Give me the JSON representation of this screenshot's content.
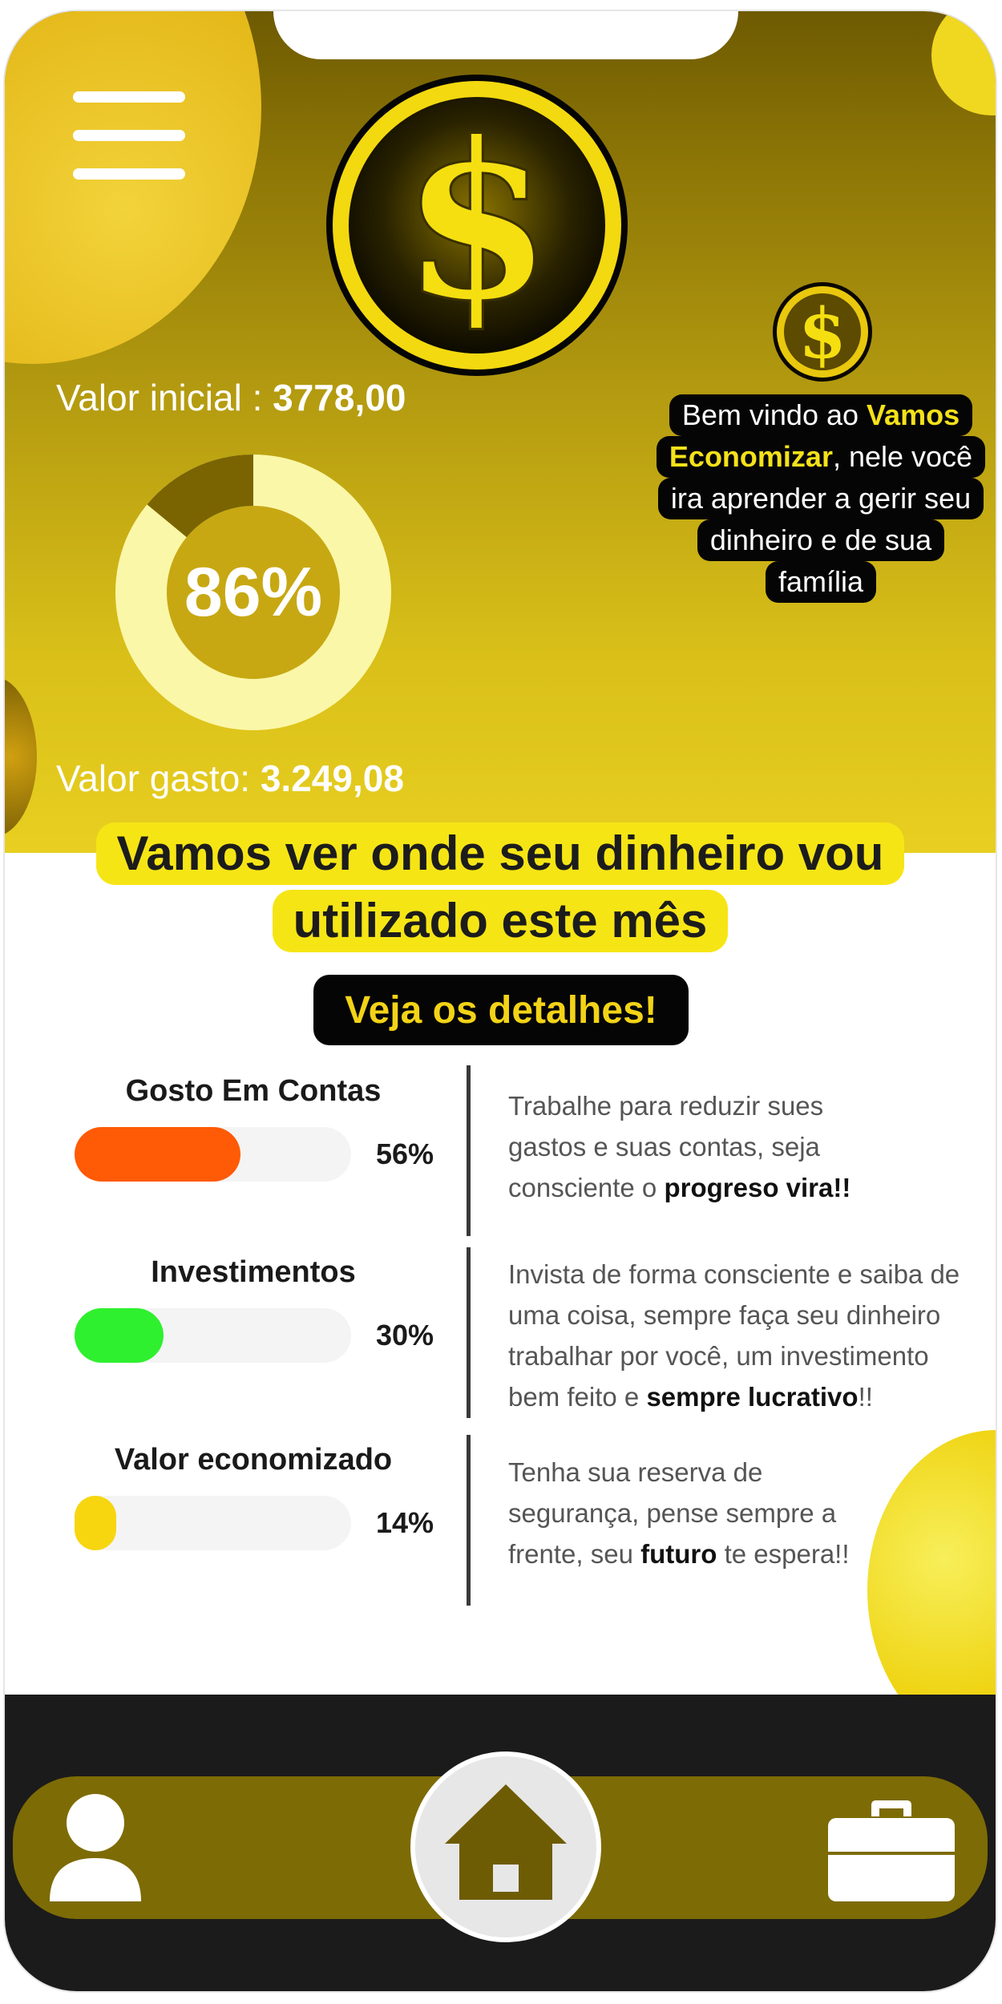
{
  "colors": {
    "accent_yellow": "#f6e515",
    "dark_gold": "#7d6b05",
    "bar_contas": "#ff5a05",
    "bar_invest": "#2ef02e",
    "bar_economia": "#f7d610",
    "track": "#f4f4f4"
  },
  "header": {
    "valor_inicial_label": "Valor inicial :",
    "valor_inicial_value": "3778,00",
    "valor_gasto_label": "Valor gasto:",
    "valor_gasto_value": "3.249,08",
    "percent_text": "86%",
    "percent_value": 86,
    "coin_symbol": "$"
  },
  "welcome": {
    "line1_prefix": "Bem vindo ao",
    "line1_highlight": "Vamos",
    "line2_highlight": "Economizar",
    "line2_suffix": ", nele você",
    "line3": "ira aprender a gerir seu",
    "line4": "dinheiro e de sua",
    "line5": "família"
  },
  "section": {
    "heading_line1": "Vamos ver onde seu dinheiro vou",
    "heading_line2": "utilizado este mês",
    "details_button": "Veja os detalhes!"
  },
  "stats": [
    {
      "title": "Gosto Em Contas",
      "percent_label": "56%",
      "percent": 56,
      "desc_line1": "Trabalhe para reduzir sues",
      "desc_line2": "gastos e suas contas, seja",
      "desc_line3_prefix": "consciente o ",
      "desc_line3_bold": "progreso vira!!"
    },
    {
      "title": "Investimentos",
      "percent_label": "30%",
      "percent": 30,
      "desc_line1": "Invista de forma consciente e saiba de",
      "desc_line2": "uma coisa, sempre faça seu dinheiro",
      "desc_line3": "trabalhar por você, um investimento",
      "desc_line4_prefix": "bem feito e ",
      "desc_line4_bold": "sempre lucrativo",
      "desc_line4_suffix": "!!"
    },
    {
      "title": "Valor economizado",
      "percent_label": "14%",
      "percent": 14,
      "desc_line1": "Tenha sua reserva de",
      "desc_line2": "segurança, pense sempre a",
      "desc_line3_prefix": "frente, seu ",
      "desc_line3_bold": "futuro",
      "desc_line3_suffix": " te espera!!"
    }
  ],
  "nav": {
    "icons": [
      "user-icon",
      "home-icon",
      "briefcase-icon"
    ]
  }
}
